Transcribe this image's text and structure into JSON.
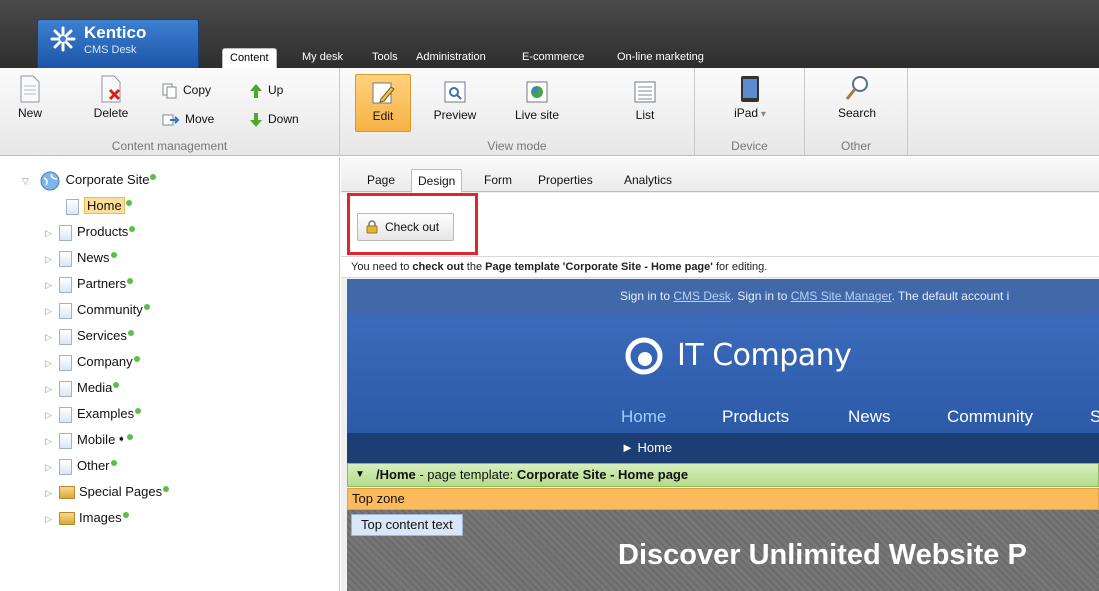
{
  "header": {
    "brand": "Kentico",
    "product": "CMS Desk",
    "tabs": [
      "Content",
      "My desk",
      "Tools",
      "Administration",
      "E-commerce",
      "On-line marketing"
    ],
    "active_tab": "Content"
  },
  "ribbon": {
    "content_management": {
      "label": "Content management",
      "new": "New",
      "delete": "Delete",
      "copy": "Copy",
      "move": "Move",
      "up": "Up",
      "down": "Down"
    },
    "view_mode": {
      "label": "View mode",
      "edit": "Edit",
      "preview": "Preview",
      "live_site": "Live site",
      "list": "List"
    },
    "device": {
      "label": "Device",
      "device": "iPad"
    },
    "other": {
      "label": "Other",
      "search": "Search"
    }
  },
  "tree": {
    "root": "Corporate Site",
    "items": [
      "Home",
      "Products",
      "News",
      "Partners",
      "Community",
      "Services",
      "Company",
      "Media",
      "Examples",
      "Mobile",
      "Other",
      "Special Pages",
      "Images"
    ],
    "selected": "Home"
  },
  "subtabs": [
    "Page",
    "Design",
    "Form",
    "Properties",
    "Analytics"
  ],
  "active_subtab": "Design",
  "checkout_label": "Check out",
  "notice": {
    "prefix": "You need to ",
    "bold1": "check out",
    "middle": " the ",
    "bold2": "Page template 'Corporate Site - Home page'",
    "suffix": " for editing."
  },
  "preview": {
    "sign_text1": "Sign in to ",
    "sign_link1": "CMS Desk",
    "sign_text2": ". Sign in to ",
    "sign_link2": "CMS Site Manager",
    "sign_text3": ". The default account i",
    "logo_text": "IT Company",
    "nav": [
      "Home",
      "Products",
      "News",
      "Community",
      "S"
    ],
    "breadcrumb": "► Home",
    "zone_path": "/Home",
    "zone_mid": " - page template: ",
    "zone_template": "Corporate Site - Home page",
    "top_zone": "Top zone",
    "content_tab": "Top content text",
    "headline": "Discover Unlimited Website P"
  },
  "colors": {
    "accent_selected": "#fddf9a",
    "highlight_box": "#e0252b",
    "site_blue": "#3c6bbd",
    "zone_green": "#b3dc8a",
    "zone_orange": "#fbbb5c"
  }
}
